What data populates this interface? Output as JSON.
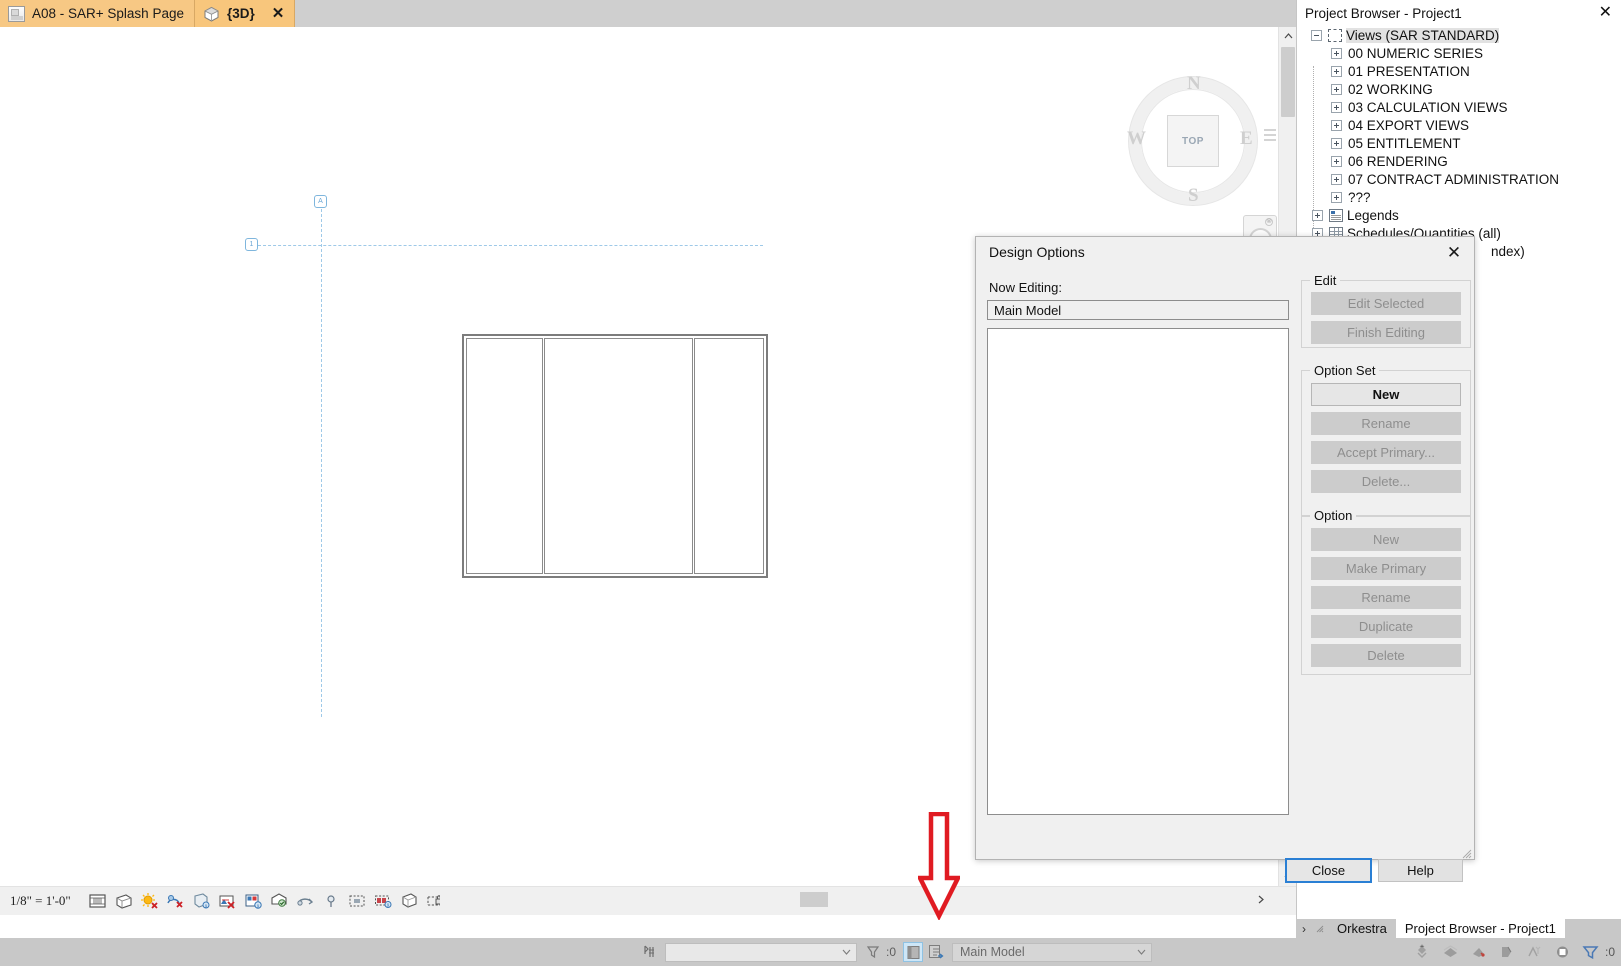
{
  "window": {
    "close_label": "✕"
  },
  "tabs": {
    "overflow_icon": "chevron-down",
    "items": [
      {
        "label": "A08 - SAR+ Splash Page",
        "icon": "sheet-icon",
        "active": false,
        "closable": false
      },
      {
        "label": "{3D}",
        "icon": "3d-cube-icon",
        "active": true,
        "closable": true,
        "close_label": "✕"
      }
    ]
  },
  "canvas": {
    "grid_bubbles": [
      {
        "label": "A",
        "kind": "vertical-grid"
      },
      {
        "label": "1",
        "kind": "horizontal-grid"
      }
    ],
    "viewcube": {
      "top_face_label": "TOP",
      "north": "N",
      "south": "S",
      "west": "W",
      "east": "E"
    },
    "steering_wheel": {
      "name": "steering-wheel-widget",
      "close_label": "⊗"
    }
  },
  "view_control_bar": {
    "scale": "1/8\" = 1'-0\"",
    "icons": [
      "crop-view-icon",
      "hide-crop-region-icon",
      "shadows-off-icon",
      "sun-path-off-icon",
      "visual-style-icon",
      "render-off-icon",
      "render-gallery-icon",
      "reveal-hidden-elements-icon",
      "temporary-hide-isolate-icon",
      "analytical-model-icon",
      "constraints-icon",
      "worksharing-display-off-icon",
      "show-render-dialog-icon",
      "unlock-3d-view-icon"
    ],
    "overflow_label": "‹"
  },
  "status_bar": {
    "modify_icon": "modify-cursor-icon",
    "workset_combo": {
      "value": "",
      "placeholder": ""
    },
    "filter_icon": "filter-icon",
    "filter_count": ":0",
    "design_option_toggle_icon": "exclude-options-icon",
    "active_option_icon": "active-design-option-icon",
    "design_option_combo": {
      "value": "Main Model",
      "chevron": "∨"
    }
  },
  "status_bar_right": {
    "icons": [
      "select-links-icon",
      "select-underlay-icon",
      "select-pinned-icon",
      "select-by-face-icon",
      "drag-elements-icon",
      "editable-only-icon"
    ],
    "filter_icon": "filter-icon",
    "filter_count": ":0"
  },
  "project_browser": {
    "title": "Project Browser - Project1",
    "close_label": "✕",
    "tree": [
      {
        "label": "Views (SAR STANDARD)",
        "level": 0,
        "icon": "views-icon",
        "expander": "minus",
        "selected": true
      },
      {
        "label": "00 NUMERIC SERIES",
        "level": 1,
        "icon": "",
        "expander": "plus",
        "selected": false
      },
      {
        "label": "01 PRESENTATION",
        "level": 1,
        "icon": "",
        "expander": "plus",
        "selected": false
      },
      {
        "label": "02 WORKING",
        "level": 1,
        "icon": "",
        "expander": "plus",
        "selected": false
      },
      {
        "label": "03 CALCULATION VIEWS",
        "level": 1,
        "icon": "",
        "expander": "plus",
        "selected": false
      },
      {
        "label": "04 EXPORT VIEWS",
        "level": 1,
        "icon": "",
        "expander": "plus",
        "selected": false
      },
      {
        "label": "05 ENTITLEMENT",
        "level": 1,
        "icon": "",
        "expander": "plus",
        "selected": false
      },
      {
        "label": "06 RENDERING",
        "level": 1,
        "icon": "",
        "expander": "plus",
        "selected": false
      },
      {
        "label": "07 CONTRACT ADMINISTRATION",
        "level": 1,
        "icon": "",
        "expander": "plus",
        "selected": false
      },
      {
        "label": "???",
        "level": 1,
        "icon": "",
        "expander": "plus",
        "selected": false
      },
      {
        "label": "Legends",
        "level": 0,
        "icon": "legend-icon",
        "expander": "plus",
        "selected": false
      },
      {
        "label": "Schedules/Quantities (all)",
        "level": 0,
        "icon": "schedule-icon",
        "expander": "plus",
        "selected": false
      }
    ],
    "obscured_row_fragment": "ndex)"
  },
  "bottom_tabs": {
    "items": [
      {
        "label": "Orkestra",
        "active": false
      },
      {
        "label": "Project Browser - Project1",
        "active": true
      }
    ]
  },
  "dialog": {
    "title": "Design Options",
    "close_label": "✕",
    "now_editing_label": "Now Editing:",
    "now_editing_value": "Main Model",
    "list_items": [],
    "groups": {
      "edit": {
        "legend": "Edit",
        "buttons": [
          {
            "label": "Edit Selected",
            "enabled": false
          },
          {
            "label": "Finish Editing",
            "enabled": false
          }
        ]
      },
      "option_set": {
        "legend": "Option Set",
        "buttons": [
          {
            "label": "New",
            "enabled": true
          },
          {
            "label": "Rename",
            "enabled": false
          },
          {
            "label": "Accept Primary...",
            "enabled": false
          },
          {
            "label": "Delete...",
            "enabled": false
          }
        ]
      },
      "option": {
        "legend": "Option",
        "buttons": [
          {
            "label": "New",
            "enabled": false
          },
          {
            "label": "Make Primary",
            "enabled": false
          },
          {
            "label": "Rename",
            "enabled": false
          },
          {
            "label": "Duplicate",
            "enabled": false
          },
          {
            "label": "Delete",
            "enabled": false
          }
        ]
      }
    },
    "footer": {
      "close": "Close",
      "help": "Help"
    }
  },
  "annotation": {
    "arrow": {
      "name": "red-down-arrow",
      "color": "#e01b22",
      "points_to": "active-design-option-icon"
    }
  },
  "colors": {
    "tab_active": "#f8c67c",
    "dialog_bg": "#f0f0f0",
    "status_bar": "#c8c8c8",
    "grid_blue": "#9ec9e8",
    "wall_gray": "#7c7c7c",
    "accent_focus": "#2a7fd4",
    "annotation_red": "#e01b22"
  }
}
